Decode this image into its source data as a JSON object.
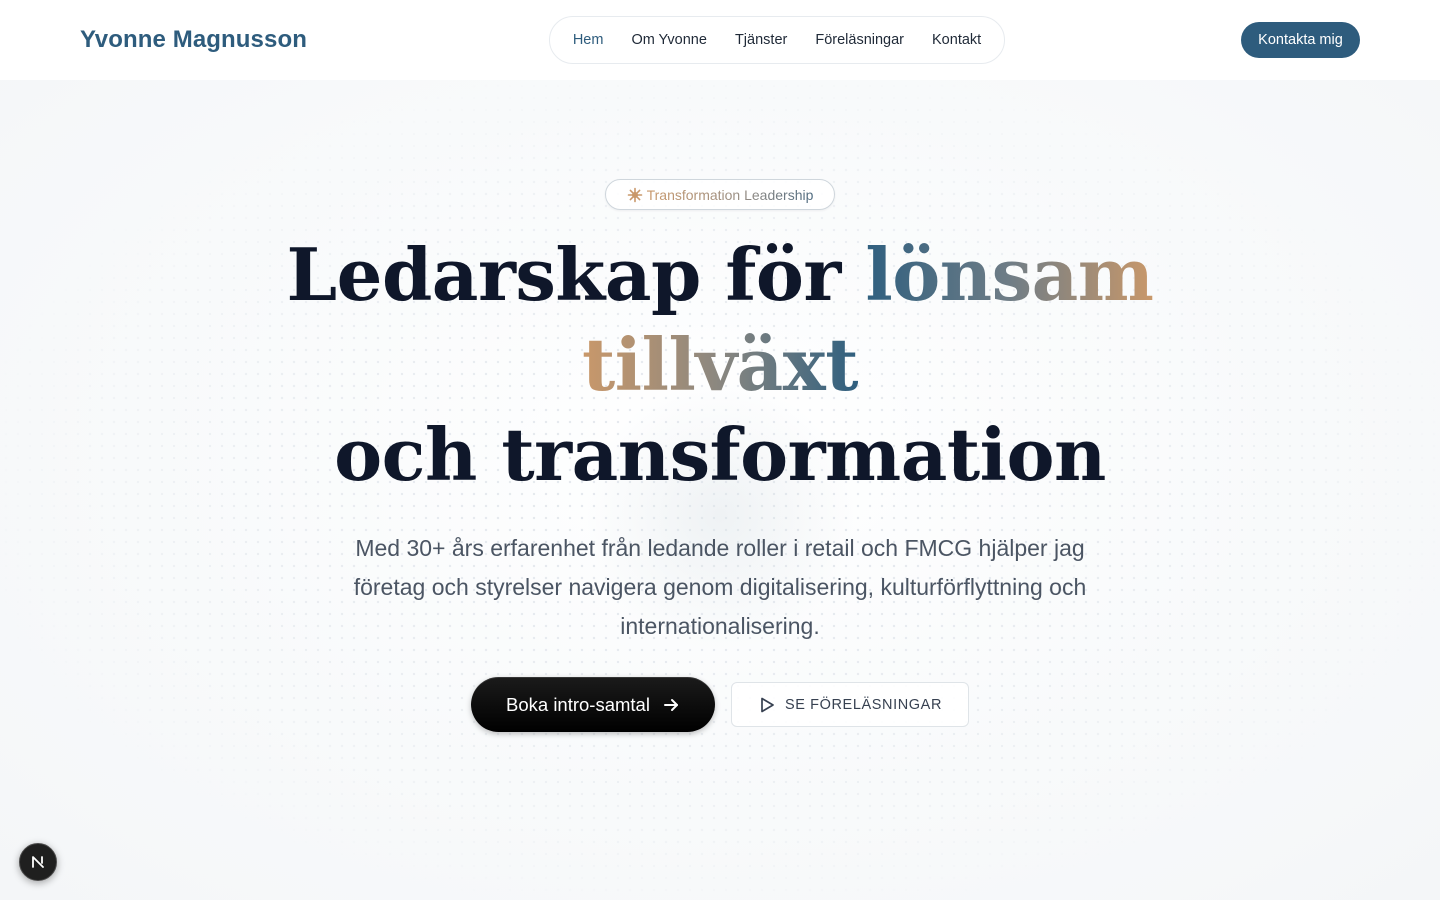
{
  "header": {
    "brand": "Yvonne Magnusson",
    "nav": [
      {
        "label": "Hem",
        "active": true
      },
      {
        "label": "Om Yvonne",
        "active": false
      },
      {
        "label": "Tjänster",
        "active": false
      },
      {
        "label": "Föreläsningar",
        "active": false
      },
      {
        "label": "Kontakt",
        "active": false
      }
    ],
    "cta": "Kontakta mig"
  },
  "hero": {
    "badge": {
      "icon": "sparkle-icon",
      "text": "Transformation Leadership"
    },
    "headline": {
      "part1": "Ledarskap för ",
      "accent1": "lönsam",
      "accent2": "tillväxt",
      "line3": "och transformation"
    },
    "lead": "Med 30+ års erfarenhet från ledande roller i retail och FMCG hjälper jag företag och styrelser navigera genom digitalisering, kulturförflyttning och internationalisering.",
    "primary_button": {
      "label": "Boka intro-samtal",
      "icon": "arrow-right-icon"
    },
    "secondary_button": {
      "label": "SE FÖRELÄSNINGAR",
      "icon": "play-icon"
    }
  },
  "dev_indicator": {
    "letter": "N",
    "icon": "nextjs-icon"
  },
  "colors": {
    "brand": "#2e5c7d",
    "gold": "#c9986a",
    "text": "#0f172a",
    "muted": "#4b5563"
  }
}
